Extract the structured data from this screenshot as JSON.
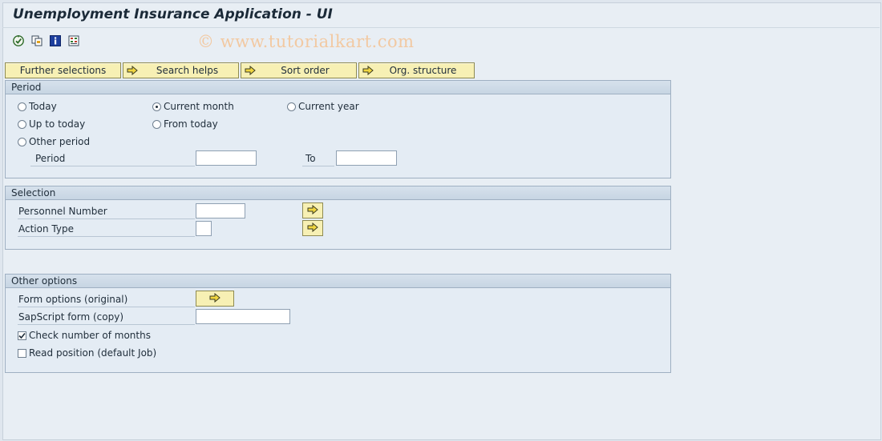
{
  "window": {
    "title": "Unemployment Insurance Application - UI"
  },
  "toolbar": {
    "icons": [
      "execute-icon",
      "variant-icon",
      "info-icon",
      "selection-options-icon"
    ]
  },
  "watermark": "© www.tutorialkart.com",
  "buttons": {
    "further_selections": "Further selections",
    "search_helps": "Search helps",
    "sort_order": "Sort order",
    "org_structure": "Org. structure"
  },
  "period": {
    "heading": "Period",
    "radios": {
      "today": "Today",
      "current_month": "Current month",
      "current_year": "Current year",
      "up_to_today": "Up to today",
      "from_today": "From today",
      "other_period": "Other period"
    },
    "selected": "current_month",
    "period_label": "Period",
    "period_from": "",
    "to_label": "To",
    "period_to": ""
  },
  "selection": {
    "heading": "Selection",
    "personnel_number_label": "Personnel Number",
    "personnel_number_value": "",
    "action_type_label": "Action Type",
    "action_type_value": ""
  },
  "other_options": {
    "heading": "Other options",
    "form_options_label": "Form options (original)",
    "sapscript_label": "SapScript form (copy)",
    "sapscript_value": "",
    "check_months_label": "Check number of months",
    "check_months_checked": true,
    "read_position_label": "Read position (default Job)",
    "read_position_checked": false
  },
  "colors": {
    "button_bg": "#f7f0b4",
    "group_bg": "#e4ecf4",
    "watermark": "#f2c9a2"
  }
}
